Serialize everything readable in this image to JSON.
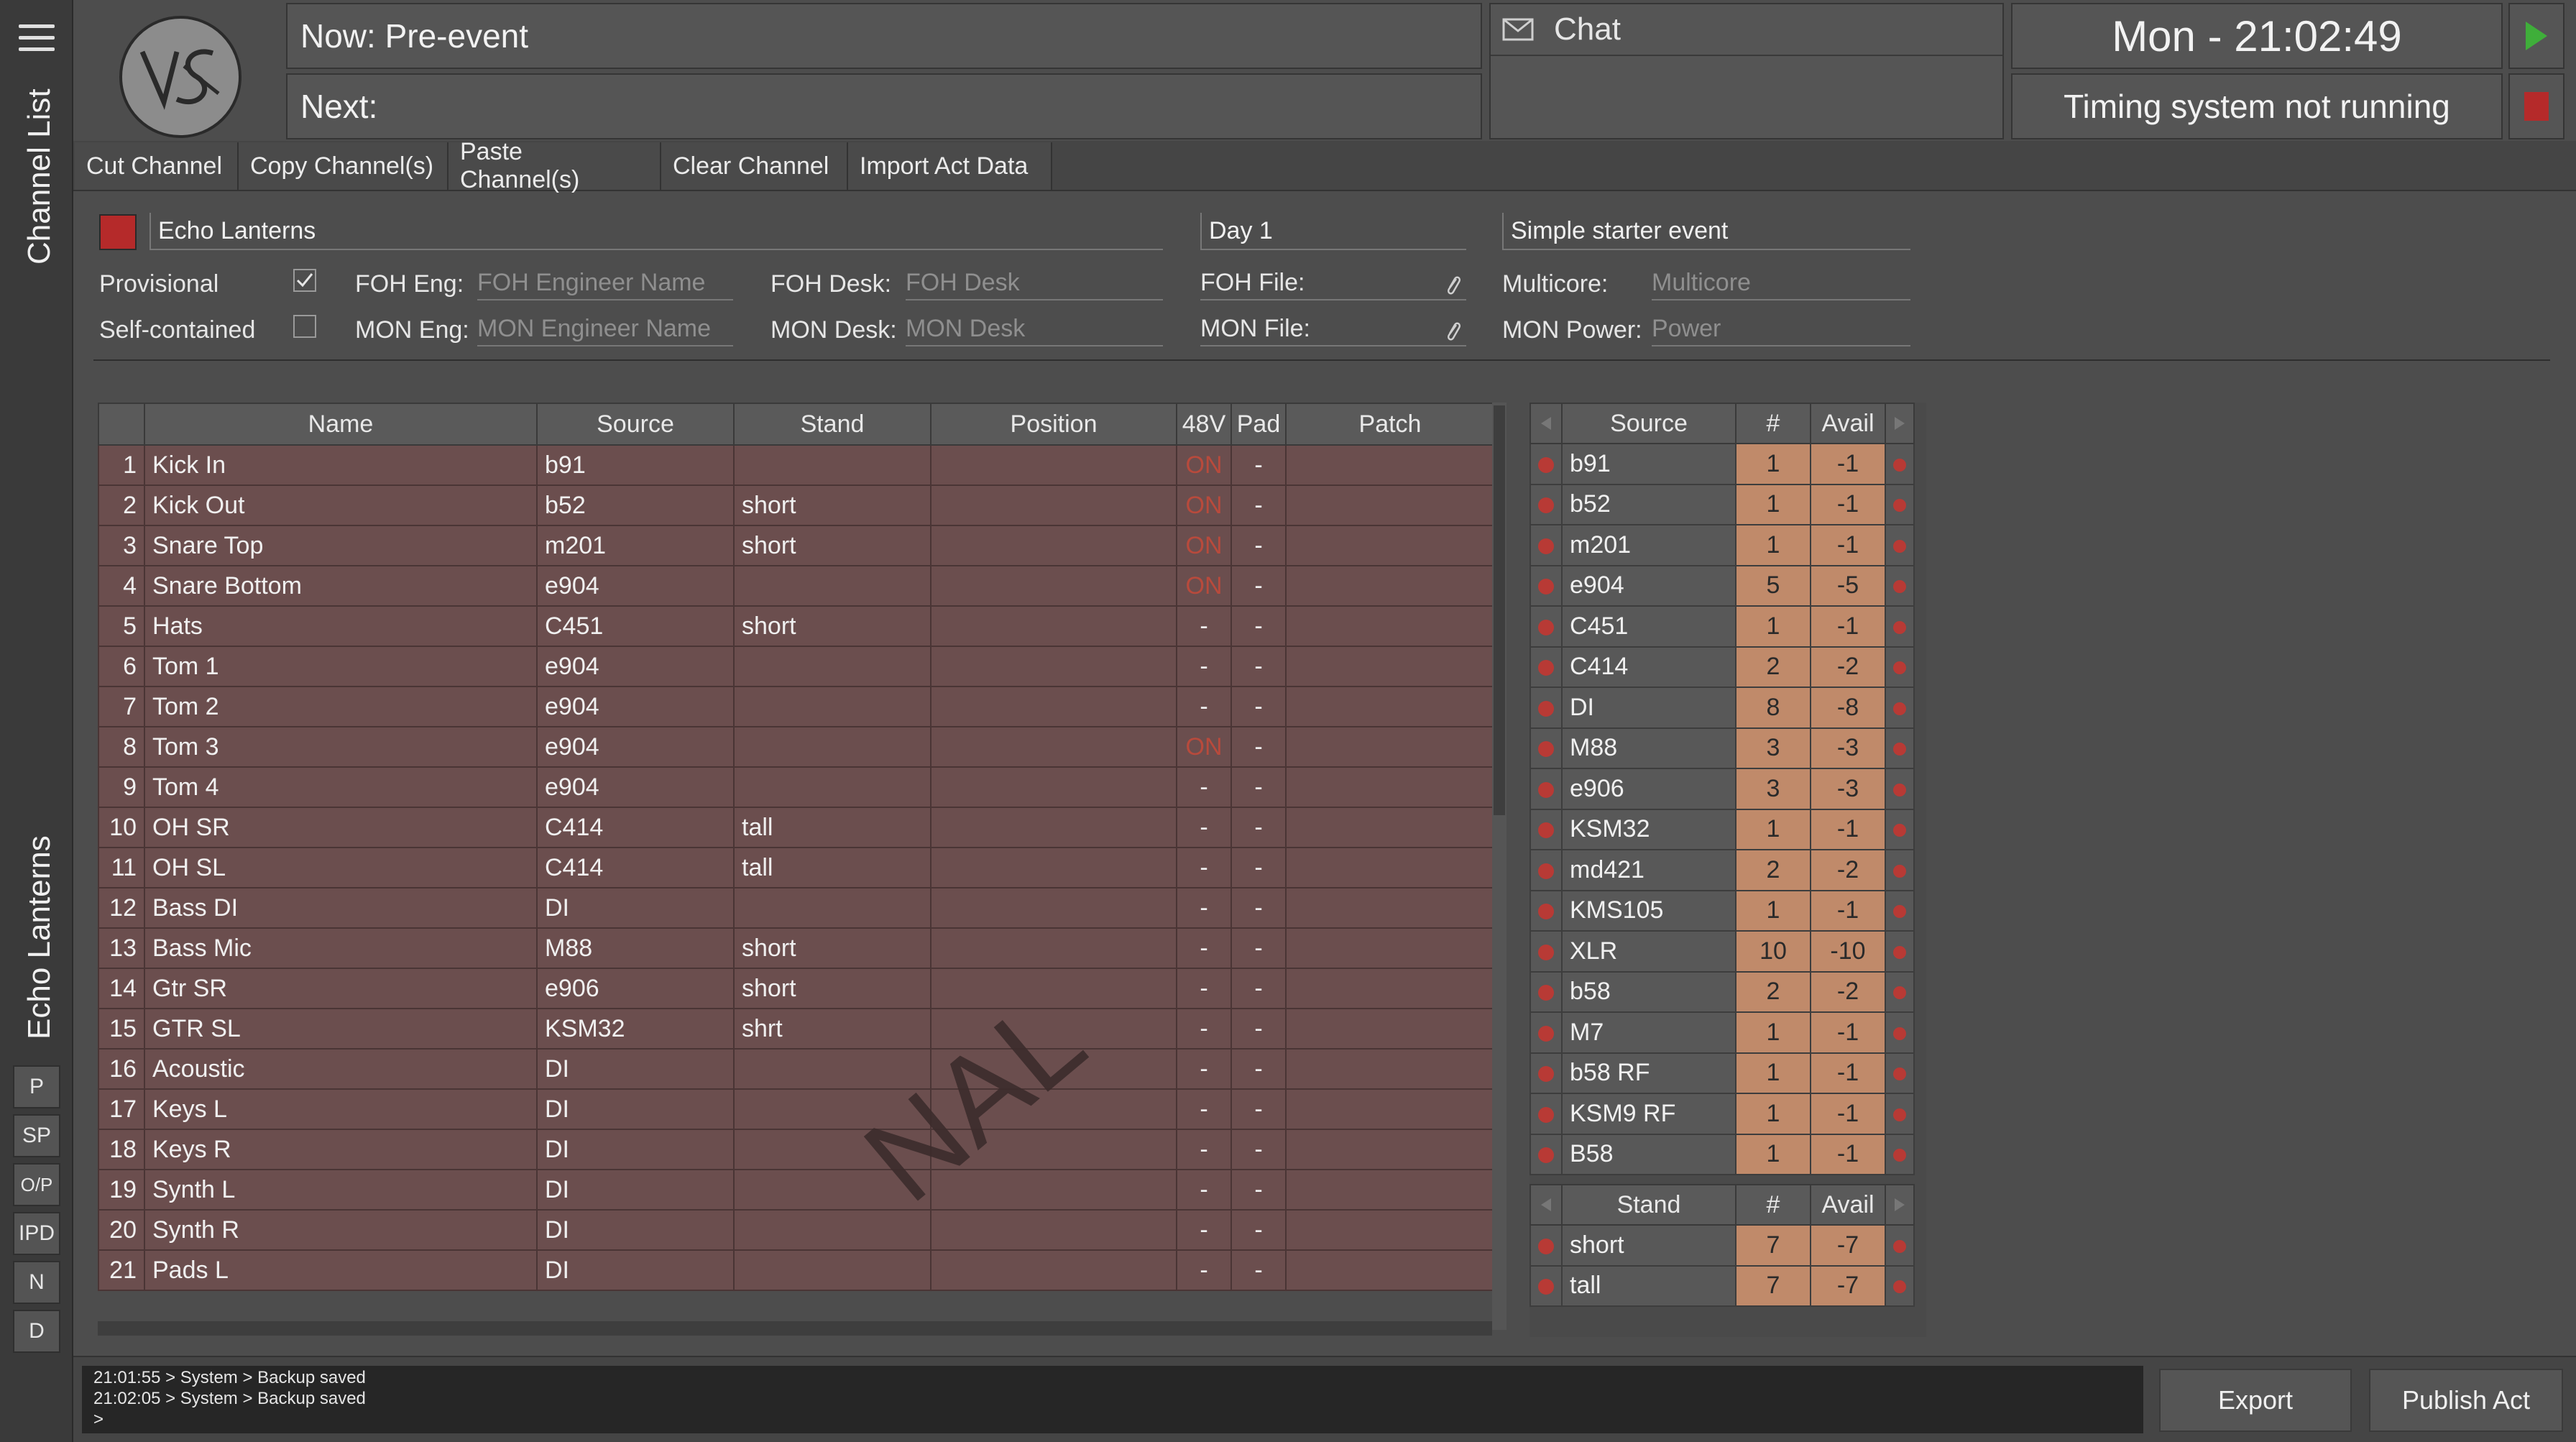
{
  "sidebar": {
    "menu_icon": "hamburger-menu-icon",
    "channel_list_label": "Channel List",
    "act_label": "Echo Lanterns",
    "buttons": [
      "P",
      "SP",
      "O/P",
      "IPD",
      "N",
      "D"
    ]
  },
  "header": {
    "now": "Now: Pre-event",
    "next": "Next:",
    "chat_label": "Chat",
    "clock": "Mon - 21:02:49",
    "timing_status": "Timing system not running",
    "logo_text": "VS"
  },
  "toolbar": {
    "cut": "Cut Channel",
    "copy": "Copy Channel(s)",
    "paste": "Paste Channel(s)",
    "clear": "Clear Channel",
    "import": "Import Act Data"
  },
  "act": {
    "name": "Echo Lanterns",
    "day": "Day 1",
    "event": "Simple starter event",
    "provisional_label": "Provisional",
    "provisional_checked": true,
    "self_contained_label": "Self-contained",
    "self_contained_checked": false,
    "foh_eng_label": "FOH Eng:",
    "foh_eng_placeholder": "FOH Engineer Name",
    "mon_eng_label": "MON Eng:",
    "mon_eng_placeholder": "MON Engineer Name",
    "foh_desk_label": "FOH Desk:",
    "foh_desk_placeholder": "FOH Desk",
    "mon_desk_label": "MON Desk:",
    "mon_desk_placeholder": "MON Desk",
    "foh_file_label": "FOH File:",
    "mon_file_label": "MON File:",
    "multicore_label": "Multicore:",
    "multicore_placeholder": "Multicore",
    "mon_power_label": "MON Power:",
    "mon_power_placeholder": "Power",
    "swatch_color": "#b52a2a",
    "watermark": "NAL"
  },
  "channel_table": {
    "columns": [
      "",
      "Name",
      "Source",
      "Stand",
      "Position",
      "48V",
      "Pad",
      "Patch"
    ],
    "rows": [
      [
        "1",
        "Kick In",
        "b91",
        "",
        "",
        "ON",
        "-",
        ""
      ],
      [
        "2",
        "Kick Out",
        "b52",
        "short",
        "",
        "ON",
        "-",
        ""
      ],
      [
        "3",
        "Snare Top",
        "m201",
        "short",
        "",
        "ON",
        "-",
        ""
      ],
      [
        "4",
        "Snare Bottom",
        "e904",
        "",
        "",
        "ON",
        "-",
        ""
      ],
      [
        "5",
        "Hats",
        "C451",
        "short",
        "",
        "-",
        "-",
        ""
      ],
      [
        "6",
        "Tom 1",
        "e904",
        "",
        "",
        "-",
        "-",
        ""
      ],
      [
        "7",
        "Tom 2",
        "e904",
        "",
        "",
        "-",
        "-",
        ""
      ],
      [
        "8",
        "Tom 3",
        "e904",
        "",
        "",
        "ON",
        "-",
        ""
      ],
      [
        "9",
        "Tom 4",
        "e904",
        "",
        "",
        "-",
        "-",
        ""
      ],
      [
        "10",
        "OH SR",
        "C414",
        "tall",
        "",
        "-",
        "-",
        ""
      ],
      [
        "11",
        "OH SL",
        "C414",
        "tall",
        "",
        "-",
        "-",
        ""
      ],
      [
        "12",
        "Bass DI",
        "DI",
        "",
        "",
        "-",
        "-",
        ""
      ],
      [
        "13",
        "Bass Mic",
        "M88",
        "short",
        "",
        "-",
        "-",
        ""
      ],
      [
        "14",
        "Gtr SR",
        "e906",
        "short",
        "",
        "-",
        "-",
        ""
      ],
      [
        "15",
        "GTR SL",
        "KSM32",
        "shrt",
        "",
        "-",
        "-",
        ""
      ],
      [
        "16",
        "Acoustic",
        "DI",
        "",
        "",
        "-",
        "-",
        ""
      ],
      [
        "17",
        "Keys L",
        "DI",
        "",
        "",
        "-",
        "-",
        ""
      ],
      [
        "18",
        "Keys R",
        "DI",
        "",
        "",
        "-",
        "-",
        ""
      ],
      [
        "19",
        "Synth L",
        "DI",
        "",
        "",
        "-",
        "-",
        ""
      ],
      [
        "20",
        "Synth R",
        "DI",
        "",
        "",
        "-",
        "-",
        ""
      ],
      [
        "21",
        "Pads L",
        "DI",
        "",
        "",
        "-",
        "-",
        ""
      ]
    ]
  },
  "source_table": {
    "columns": [
      "Source",
      "#",
      "Avail"
    ],
    "rows": [
      [
        "b91",
        "1",
        "-1"
      ],
      [
        "b52",
        "1",
        "-1"
      ],
      [
        "m201",
        "1",
        "-1"
      ],
      [
        "e904",
        "5",
        "-5"
      ],
      [
        "C451",
        "1",
        "-1"
      ],
      [
        "C414",
        "2",
        "-2"
      ],
      [
        "DI",
        "8",
        "-8"
      ],
      [
        "M88",
        "3",
        "-3"
      ],
      [
        "e906",
        "3",
        "-3"
      ],
      [
        "KSM32",
        "1",
        "-1"
      ],
      [
        "md421",
        "2",
        "-2"
      ],
      [
        "KMS105",
        "1",
        "-1"
      ],
      [
        "XLR",
        "10",
        "-10"
      ],
      [
        "b58",
        "2",
        "-2"
      ],
      [
        "M7",
        "1",
        "-1"
      ],
      [
        "b58 RF",
        "1",
        "-1"
      ],
      [
        "KSM9 RF",
        "1",
        "-1"
      ],
      [
        "B58",
        "1",
        "-1"
      ]
    ]
  },
  "stand_table": {
    "columns": [
      "Stand",
      "#",
      "Avail"
    ],
    "rows": [
      [
        "short",
        "7",
        "-7"
      ],
      [
        "tall",
        "7",
        "-7"
      ]
    ]
  },
  "log": {
    "lines": [
      "21:01:55 > System > Backup saved",
      "21:02:05 > System > Backup saved",
      ">"
    ]
  },
  "footer": {
    "export": "Export",
    "publish": "Publish Act"
  },
  "colors": {
    "accent_red": "#b83a35",
    "play_green": "#3fae3a",
    "row_bg": "#6b4e4e",
    "qty_bg": "#c08a6a"
  }
}
